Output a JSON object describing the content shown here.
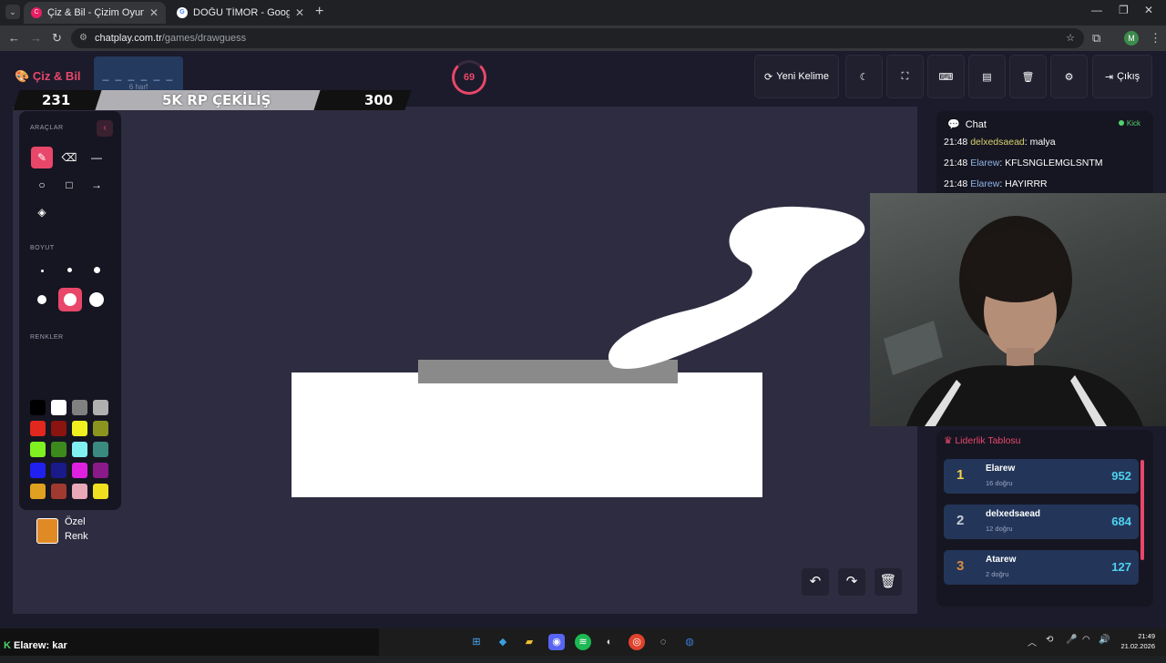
{
  "browser": {
    "tabs": [
      {
        "title": "Çiz & Bil - Çizim Oyunu",
        "active": true
      },
      {
        "title": "DOĞU TİMOR - Google'da Ara",
        "active": false
      }
    ],
    "url_host": "chatplay.com.tr",
    "url_path": "/games/drawguess",
    "profile_initial": "M"
  },
  "header": {
    "logo": "Çiz & Bil",
    "word_blanks": "_ _ _ _ _ _",
    "word_hint": "6 harf",
    "timer": "69",
    "new_word": "Yeni Kelime",
    "exit": "Çıkış"
  },
  "banner": {
    "left": "231",
    "center": "5K RP ÇEKİLİŞ",
    "right": "300"
  },
  "tools": {
    "tools_label": "ARAÇLAR",
    "size_label": "BOYUT",
    "colors_label": "RENKLER",
    "custom_color_label1": "Özel",
    "custom_color_label2": "Renk",
    "custom_color": "#e08a25",
    "swatches": [
      "#000000",
      "#ffffff",
      "#808080",
      "#b0b0b0",
      "#e0281e",
      "#8b1410",
      "#f0f020",
      "#8c9420",
      "#80f020",
      "#3c8a1e",
      "#80f0f0",
      "#3a8a80",
      "#2020f0",
      "#1a1a8a",
      "#e020e0",
      "#8a1a8a",
      "#e0a020",
      "#a03a30",
      "#e8a8b8",
      "#f0e020"
    ]
  },
  "chat": {
    "title": "Chat",
    "status": "Kick",
    "messages": [
      {
        "time": "21:48",
        "user": "delxedsaead",
        "text": ": malya"
      },
      {
        "time": "21:48",
        "user": "Elarew",
        "text": ": KFLSNGLEMGLSNTM"
      },
      {
        "time": "21:48",
        "user": "Elarew",
        "text": ": HAYIRRR"
      }
    ]
  },
  "leaderboard": {
    "title": "Liderlik Tablosu",
    "rows": [
      {
        "rank": "1",
        "name": "Elarew",
        "sub": "16 doğru",
        "score": "952",
        "rank_color": "#f5d04a"
      },
      {
        "rank": "2",
        "name": "delxedsaead",
        "sub": "12 doğru",
        "score": "684",
        "rank_color": "#c8ccd8"
      },
      {
        "rank": "3",
        "name": "Atarew",
        "sub": "2 doğru",
        "score": "127",
        "rank_color": "#d88a40"
      }
    ]
  },
  "bottom_chat": {
    "user": "Elarew",
    "text": ": kar"
  },
  "clock": {
    "time": "21:49",
    "date": "21.02.2026"
  },
  "accent": "#e8476a"
}
